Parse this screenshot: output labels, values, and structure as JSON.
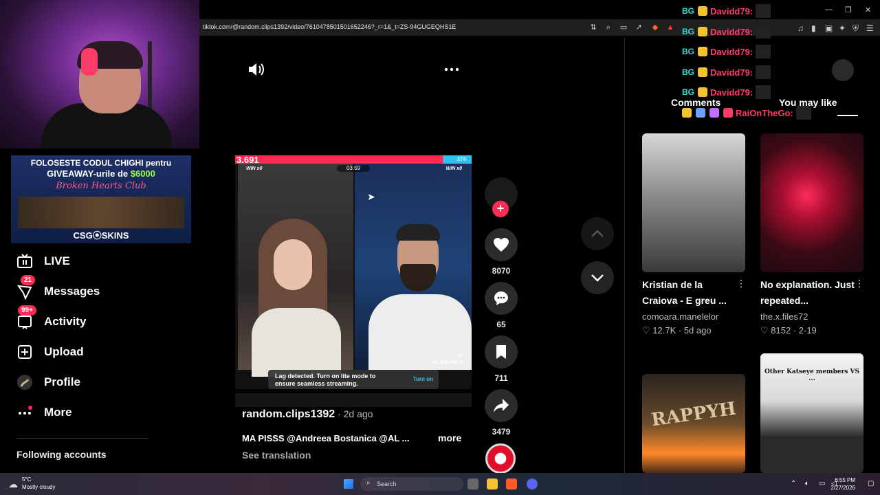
{
  "browser": {
    "url": "tiktok.com/@random.clips1392/video/7610478501501652246?_r=1&_t=ZS-94GUGEQHS1E"
  },
  "ad": {
    "line1": "FOLOSESTE CODUL CHIGHI pentru",
    "line2_prefix": "GIVEAWAY-urile de ",
    "line2_amount": "$6000",
    "club": "Broken Hearts Club",
    "brand": "CSG⦿SKINS"
  },
  "sidebar": {
    "items": [
      {
        "label": "LIVE",
        "icon": "live-tv-icon"
      },
      {
        "label": "Messages",
        "icon": "messages-icon",
        "badge": "21"
      },
      {
        "label": "Activity",
        "icon": "activity-icon",
        "badge": "99+"
      },
      {
        "label": "Upload",
        "icon": "upload-icon"
      },
      {
        "label": "Profile",
        "icon": "profile-avatar"
      },
      {
        "label": "More",
        "icon": "more-icon"
      }
    ],
    "following": "Following accounts"
  },
  "video": {
    "score_left": "3.691",
    "score_right": "374",
    "timer": "03:59",
    "win_left": "WIN x0",
    "win_right": "WIN x0",
    "name_right": "AL RAFAELO",
    "multiplier": "x1",
    "lag_text": "Lag detected. Turn on lite mode to ensure seamless streaming.",
    "lag_button": "Turn on",
    "author": "random.clips1392",
    "date": " · 2d ago",
    "caption": "MA PISSS @Andreea Bostanica @AL ...",
    "more": "more",
    "see_translation": "See translation"
  },
  "actions": {
    "likes": "8070",
    "comments": "65",
    "saves": "711",
    "shares": "3479"
  },
  "right": {
    "tab_comments": "Comments",
    "tab_you_may_like": "You may like",
    "cards": [
      {
        "title": "Kristian de la Craiova - E greu ...",
        "author": "comoara.manelelor",
        "likes": "12.7K",
        "age": "5d ago"
      },
      {
        "title": "No explanation. Just repeated...",
        "author": "the.x.files72",
        "likes": "8152",
        "age": "2-19"
      },
      {
        "title": "",
        "author": "",
        "likes": "",
        "age": "",
        "thumb_text": "RAPPYH"
      },
      {
        "title": "",
        "author": "",
        "likes": "",
        "age": "",
        "thumb_text": "Other Katseye members VS ..."
      }
    ]
  },
  "chat": {
    "rows": [
      {
        "tag": "BG",
        "name": "Davidd79:"
      },
      {
        "tag": "BG",
        "name": "Davidd79:"
      },
      {
        "tag": "BG",
        "name": "Davidd79:"
      },
      {
        "tag": "BG",
        "name": "Davidd79:"
      },
      {
        "tag": "BG",
        "name": "Davidd79:"
      },
      {
        "tag": "",
        "name": "RaiOnTheGo:"
      }
    ]
  },
  "taskbar": {
    "temp": "5°C",
    "weather": "Mostly cloudy",
    "search": "Search",
    "time": "6:55 PM",
    "date": "2/27/2026"
  },
  "colors": {
    "accent": "#fe2c55",
    "chat_name": "#ff3b6a",
    "chat_tag": "#2ee0d0",
    "lag_button": "#2ec4f0"
  }
}
